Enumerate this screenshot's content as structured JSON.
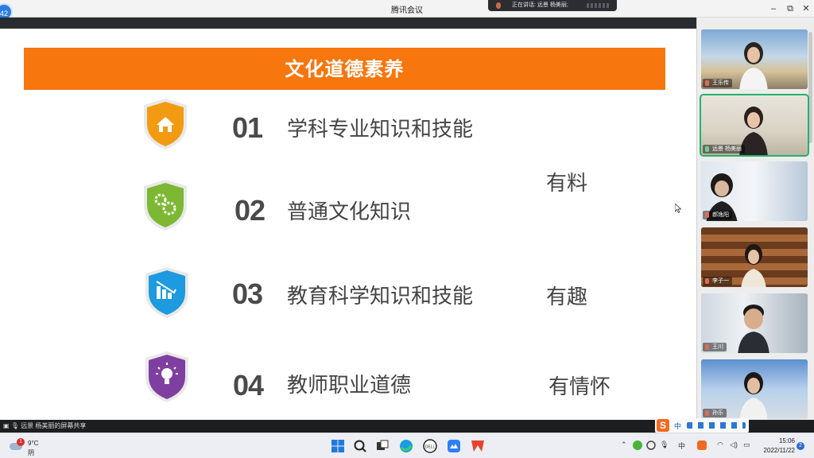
{
  "window": {
    "title": "腾讯会议",
    "badge": "42",
    "speaking": "正在讲话: 远景 杨美丽;",
    "minimize": "–",
    "restore": "⧉",
    "close": "✕"
  },
  "slide": {
    "banner": "文化道德素养",
    "items": [
      {
        "num": "01",
        "label": "学科专业知识和技能",
        "color": "#f29b12",
        "icon": "house-icon"
      },
      {
        "num": "02",
        "label": "普通文化知识",
        "color": "#7cb833",
        "icon": "gears-icon"
      },
      {
        "num": "03",
        "label": "教育科学知识和技能",
        "color": "#1d9ae0",
        "icon": "bar-chart-icon"
      },
      {
        "num": "04",
        "label": "教师职业道德",
        "color": "#7f3fa0",
        "icon": "lightbulb-icon"
      }
    ],
    "side_labels": [
      "有料",
      "有趣",
      "有情怀"
    ]
  },
  "participants": [
    {
      "name": "王乐传"
    },
    {
      "name": "远景 杨美丽"
    },
    {
      "name": "郝逸阳"
    },
    {
      "name": "李子一"
    },
    {
      "name": "王川"
    },
    {
      "name": "孙乐"
    }
  ],
  "sharebar": {
    "text": "远景 杨美丽的屏幕共享"
  },
  "ime": {
    "logo": "S",
    "mode": "中"
  },
  "taskbar": {
    "weather_badge": "1",
    "temperature": "9°C",
    "condition": "阴",
    "time": "15:06",
    "date": "2022/11/22",
    "notifications": "2"
  }
}
